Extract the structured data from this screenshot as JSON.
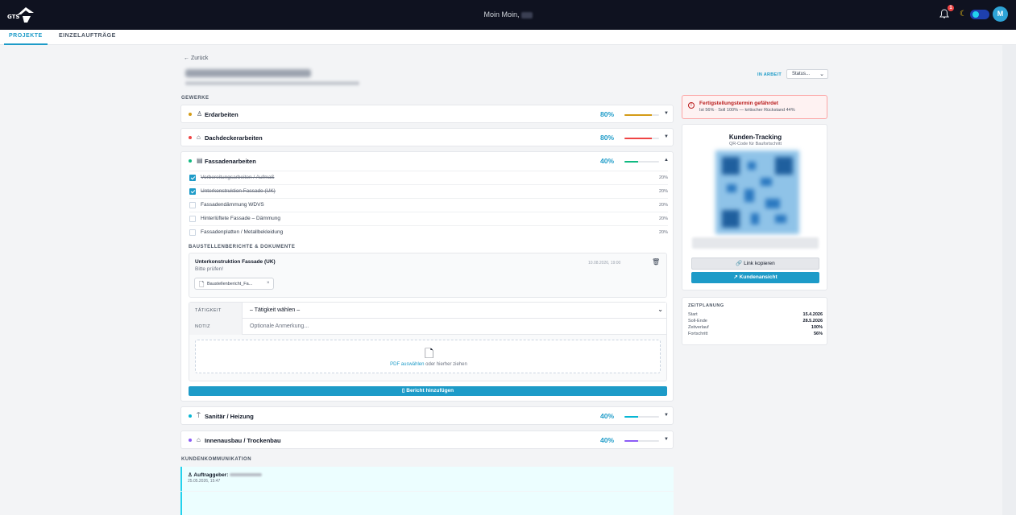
{
  "header": {
    "logo_text": "GTS",
    "greeting": "Moin Moin,",
    "notification_count": "1",
    "avatar_initial": "M"
  },
  "nav": {
    "tabs": [
      {
        "label": "PROJEKTE",
        "active": true
      },
      {
        "label": "EINZELAUFTRÄGE",
        "active": false
      }
    ]
  },
  "project": {
    "back_label": "← Zurück",
    "status_label": "IN ARBEIT",
    "status_select": "Status..."
  },
  "trades": {
    "section_label": "GEWERKE",
    "items": [
      {
        "name": "Erdarbeiten",
        "icon": "worker-icon",
        "dot_color": "#d49b16",
        "percent_text": "80%",
        "percent": 80,
        "bar_color": "#d49b16",
        "expanded": false
      },
      {
        "name": "Dachdeckerarbeiten",
        "icon": "roof-icon",
        "dot_color": "#ef4444",
        "percent_text": "80%",
        "percent": 80,
        "bar_color": "#ef4444",
        "expanded": false
      },
      {
        "name": "Fassadenarbeiten",
        "icon": "facade-icon",
        "dot_color": "#10b981",
        "percent_text": "40%",
        "percent": 40,
        "bar_color": "#10b981",
        "expanded": true
      },
      {
        "name": "Sanitär / Heizung",
        "icon": "shower-icon",
        "dot_color": "#06b6d4",
        "percent_text": "40%",
        "percent": 40,
        "bar_color": "#06b6d4",
        "expanded": false
      },
      {
        "name": "Innenausbau / Trockenbau",
        "icon": "house-icon",
        "dot_color": "#8b5cf6",
        "percent_text": "40%",
        "percent": 40,
        "bar_color": "#8b5cf6",
        "expanded": false
      }
    ]
  },
  "tasks": [
    {
      "label": "Vorbereitungsarbeiten / Aufmaß",
      "percent": "20%",
      "done": true
    },
    {
      "label": "Unterkonstruktion Fassade (UK)",
      "percent": "20%",
      "done": true
    },
    {
      "label": "Fassadendämmung WDVS",
      "percent": "20%",
      "done": false
    },
    {
      "label": "Hinterlüftete Fassade – Dämmung",
      "percent": "20%",
      "done": false
    },
    {
      "label": "Fassadenplatten / Metallbekleidung",
      "percent": "20%",
      "done": false
    }
  ],
  "reports": {
    "section_label": "BAUSTELLENBERICHTE & DOKUMENTE",
    "entry": {
      "title": "Unterkonstruktion Fassade (UK)",
      "note": "Bitte prüfen!",
      "date": "10.08.2026, 19:00",
      "file": "Baustellenbericht_Fa...",
      "file_remove": "×"
    },
    "form": {
      "activity_key": "TÄTIGKEIT",
      "activity_value": "– Tätigkeit wählen –",
      "note_key": "NOTIZ",
      "note_placeholder": "Optionale Anmerkung...",
      "upload_link": "PDF auswählen",
      "upload_rest": " oder hierher ziehen"
    },
    "add_button": "Bericht hinzufügen"
  },
  "communication": {
    "section_label": "KUNDENKOMMUNIKATION",
    "entry": {
      "author_label": "Auftraggeber:",
      "date": "25.05.2026, 15:47"
    }
  },
  "alert": {
    "title": "Fertigstellungstermin gefährdet",
    "detail": "Ist 56% · Soll 100% — kritischer Rückstand 44%"
  },
  "tracking": {
    "title": "Kunden-Tracking",
    "subtitle": "QR-Code für Baufortschritt",
    "copy_button": "Link kopieren",
    "customer_button": "Kundenansicht"
  },
  "schedule": {
    "title": "ZEITPLANUNG",
    "rows": [
      {
        "key": "Start",
        "value": "15.4.2026"
      },
      {
        "key": "Soll-Ende",
        "value": "28.5.2026"
      },
      {
        "key": "Zeitverlauf",
        "value": "100%"
      },
      {
        "key": "Fortschritt",
        "value": "56%"
      }
    ]
  }
}
